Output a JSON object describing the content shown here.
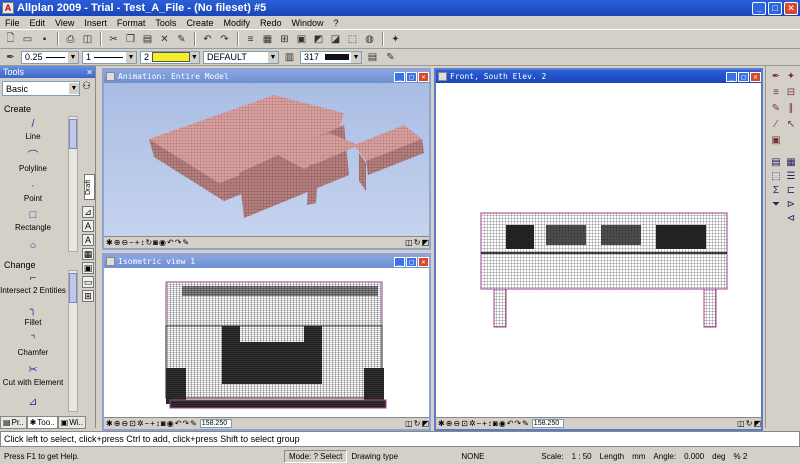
{
  "app": {
    "title": "Allplan 2009 - Trial - Test_A_File - (No fileset) #5",
    "icon_glyph": "A"
  },
  "menu": [
    "File",
    "Edit",
    "View",
    "Insert",
    "Format",
    "Tools",
    "Create",
    "Modify",
    "Redo",
    "Window",
    "?"
  ],
  "toolbar2": {
    "pen_thickness": "0.25",
    "line_type": "1",
    "color_number": "2",
    "layer": "DEFAULT",
    "hatch_number": "317"
  },
  "palette": {
    "title": "Tools",
    "family": "Basic",
    "draft_tab": "Draft",
    "create_heading": "Create",
    "change_heading": "Change",
    "create_items": [
      {
        "label": "Line",
        "icon": "/"
      },
      {
        "label": "Polyline",
        "icon": "⌒"
      },
      {
        "label": "Point",
        "icon": "·"
      },
      {
        "label": "Rectangle",
        "icon": "□"
      },
      {
        "label": "",
        "icon": "○"
      }
    ],
    "change_items": [
      {
        "label": "Intersect 2 Entities",
        "icon": "⌐"
      },
      {
        "label": "Fillet",
        "icon": "╮"
      },
      {
        "label": "Chamfer",
        "icon": "⌝"
      },
      {
        "label": "Cut with Element",
        "icon": "✂"
      },
      {
        "label": "",
        "icon": "⊿"
      }
    ],
    "tabs": [
      "Pr..",
      "Too..",
      "Wi.."
    ]
  },
  "windows": {
    "animation": {
      "title": "Animation: Entire Model"
    },
    "isometric": {
      "title": "Isometric view 1",
      "zoom": "158.250"
    },
    "front": {
      "title": "Front, South Elev. 2",
      "zoom": "158.250"
    }
  },
  "prompt": "Click left to select, click+press Ctrl to add, click+press Shift to select group",
  "status": {
    "help": "Press F1 to get Help.",
    "mode_label": "Mode:",
    "mode_value": "? Select",
    "drawing_type_label": "Drawing type",
    "drawing_type_value": "NONE",
    "scale_label": "Scale:",
    "scale_value": "1 : 50",
    "length_label": "Length",
    "length_unit": "mm",
    "angle_label": "Angle:",
    "angle_value": "0.000",
    "angle_unit": "deg",
    "percent": "% 2"
  }
}
